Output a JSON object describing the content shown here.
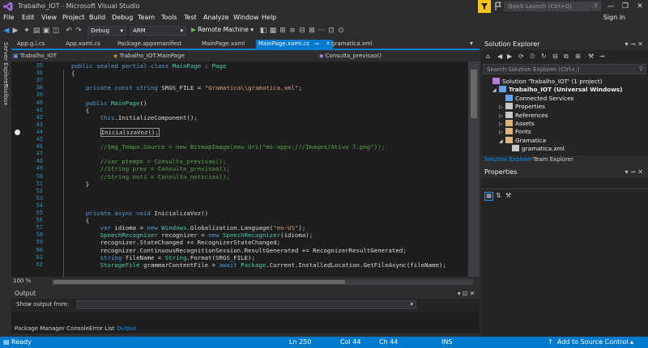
{
  "window": {
    "title": "Trabalho_IOT - Microsoft Visual Studio",
    "quick_launch_placeholder": "Quick Launch (Ctrl+Q)",
    "controls": [
      "—",
      "❐",
      "✕"
    ]
  },
  "menu": {
    "items": [
      "File",
      "Edit",
      "View",
      "Project",
      "Build",
      "Debug",
      "Team",
      "Tools",
      "Test",
      "Analyze",
      "Window",
      "Help"
    ],
    "sign_in": "Sign in"
  },
  "toolbar": {
    "configuration": "Debug",
    "platform": "ARM",
    "run_target": "Remote Machine"
  },
  "left_strip": {
    "server_explorer": "Server Explorer",
    "toolbox": "Toolbox"
  },
  "doc_tabs": [
    {
      "label": "App.g.i.cs",
      "active": false
    },
    {
      "label": "App.xaml.cs",
      "active": false
    },
    {
      "label": "Package.appxmanifest",
      "active": false
    },
    {
      "label": "MainPage.xaml",
      "active": false
    },
    {
      "label": "MainPage.xaml.cs",
      "active": true
    },
    {
      "label": "gramatica.xml",
      "active": false
    }
  ],
  "nav_bar": {
    "project": "Trabalho_IOT",
    "type": "Trabalho_IOT.MainPage",
    "member": "Consulta_previsao()"
  },
  "editor": {
    "lines": [
      {
        "n": "35",
        "text": "public sealed partial class MainPage : Page"
      },
      {
        "n": "36",
        "text": "{"
      },
      {
        "n": "37",
        "text": ""
      },
      {
        "n": "38",
        "text": "    private const string SRGS_FILE = \"Gramatica\\\\gramatica.xml\";"
      },
      {
        "n": "39",
        "text": ""
      },
      {
        "n": "40",
        "text": "    public MainPage()"
      },
      {
        "n": "41",
        "text": "    {"
      },
      {
        "n": "42",
        "text": "        this.InitializeComponent();"
      },
      {
        "n": "43",
        "text": ""
      },
      {
        "n": "44",
        "text": "        InicializaVoz();"
      },
      {
        "n": "45",
        "text": ""
      },
      {
        "n": "46",
        "text": "        //Img_Tempo.Source = new BitmapImage(new Uri(\"ms-appx:///Images/Ativo 7.png\"));"
      },
      {
        "n": "47",
        "text": ""
      },
      {
        "n": "48",
        "text": "        //var ptempo = Consulta_previsao();"
      },
      {
        "n": "49",
        "text": "        //String prev = Consulta_previsao();"
      },
      {
        "n": "50",
        "text": "        //String noti = Consulta_noticias();"
      },
      {
        "n": "51",
        "text": "    }"
      },
      {
        "n": "52",
        "text": ""
      },
      {
        "n": "53",
        "text": ""
      },
      {
        "n": "54",
        "text": ""
      },
      {
        "n": "55",
        "text": "    private async void InicializaVoz()"
      },
      {
        "n": "56",
        "text": "    {"
      },
      {
        "n": "57",
        "text": "        var idioma = new Windows.Globalization.Language(\"en-US\");"
      },
      {
        "n": "58",
        "text": "        SpeechRecognizer recognizer = new SpeechRecognizer(idioma);"
      },
      {
        "n": "59",
        "text": "        recognizer.StateChanged += RecognizerStateChanged;"
      },
      {
        "n": "60",
        "text": "        recognizer.ContinuousRecognitionSession.ResultGenerated += RecognizerResultGenerated;"
      },
      {
        "n": "61",
        "text": "        string fileName = String.Format(SRGS_FILE);"
      },
      {
        "n": "62",
        "text": "        StorageFile grammarContentFile = await Package.Current.InstalledLocation.GetFileAsync(fileName);"
      }
    ],
    "zoom": "100 %"
  },
  "output_panel": {
    "title": "Output",
    "show_output_from": "Show output from:",
    "controls": "▾ ⊡ ✕"
  },
  "bottom_tabs": [
    {
      "label": "Package Manager Console",
      "active": false
    },
    {
      "label": "Error List",
      "active": false
    },
    {
      "label": "Output",
      "active": true
    }
  ],
  "solution_explorer": {
    "title": "Solution Explorer",
    "search_placeholder": "Search Solution Explorer (Ctrl+;)",
    "tree": [
      {
        "label": "Solution 'Trabalho_IOT' (1 project)",
        "indent": 0,
        "arrow": "",
        "bold": false,
        "icon": "solution-icon"
      },
      {
        "label": "Trabalho_IOT (Universal Windows)",
        "indent": 1,
        "arrow": "◢",
        "bold": true,
        "icon": "csharp-project-icon"
      },
      {
        "label": "Connected Services",
        "indent": 2,
        "arrow": "",
        "bold": false,
        "icon": "connected-services-icon"
      },
      {
        "label": "Properties",
        "indent": 2,
        "arrow": "▷",
        "bold": false,
        "icon": "wrench-icon"
      },
      {
        "label": "References",
        "indent": 2,
        "arrow": "▷",
        "bold": false,
        "icon": "references-icon"
      },
      {
        "label": "Assets",
        "indent": 2,
        "arrow": "▷",
        "bold": false,
        "icon": "folder-icon"
      },
      {
        "label": "Fonts",
        "indent": 2,
        "arrow": "▷",
        "bold": false,
        "icon": "folder-icon"
      },
      {
        "label": "Gramatica",
        "indent": 2,
        "arrow": "◢",
        "bold": false,
        "icon": "folder-open-icon"
      },
      {
        "label": "gramatica.xml",
        "indent": 3,
        "arrow": "",
        "bold": false,
        "icon": "xml-file-icon"
      }
    ],
    "tabs": [
      {
        "label": "Solution Explorer",
        "active": true
      },
      {
        "label": "Team Explorer",
        "active": false
      }
    ]
  },
  "properties": {
    "title": "Properties"
  },
  "status_bar": {
    "ready": "Ready",
    "ln": "Ln 250",
    "col": "Col 44",
    "ch": "Ch 44",
    "ins": "INS",
    "source_control": "Add to Source Control"
  },
  "colors": {
    "accent": "#007acc",
    "background": "#2d2d30",
    "editor_bg": "#1e1e1e"
  }
}
